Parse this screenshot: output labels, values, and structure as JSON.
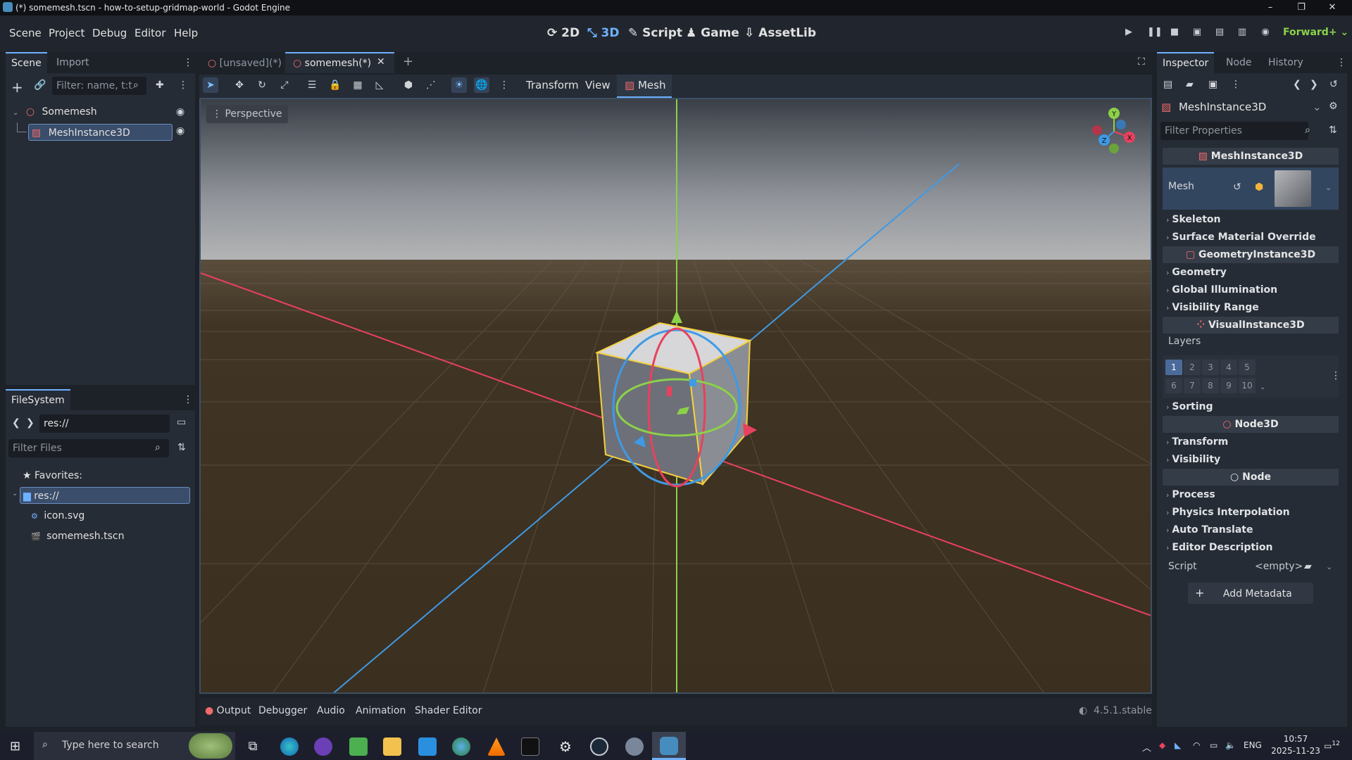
{
  "window": {
    "title": "(*) somemesh.tscn - how-to-setup-gridmap-world - Godot Engine",
    "minimize": "–",
    "maximize": "❐",
    "close": "✕"
  },
  "menu": {
    "scene": "Scene",
    "project": "Project",
    "debug": "Debug",
    "editor": "Editor",
    "help": "Help"
  },
  "modes": {
    "m2d": "2D",
    "m3d": "3D",
    "script": "Script",
    "game": "Game",
    "assetlib": "AssetLib"
  },
  "renderer": "Forward+",
  "scene_dock": {
    "tabs": [
      "Scene",
      "Import"
    ],
    "filter_placeholder": "Filter: name, t:t",
    "nodes": [
      {
        "name": "Somemesh"
      },
      {
        "name": "MeshInstance3D"
      }
    ]
  },
  "filesystem": {
    "tab": "FileSystem",
    "path": "res://",
    "filter_placeholder": "Filter Files",
    "favorites": "Favorites:",
    "root": "res://",
    "files": [
      "icon.svg",
      "somemesh.tscn"
    ]
  },
  "editor_tabs": {
    "tab1": "[unsaved](*)",
    "tab2": "somemesh(*)",
    "add": "+"
  },
  "viewport_toolbar": {
    "transform": "Transform",
    "view": "View",
    "mesh": "Mesh"
  },
  "viewport": {
    "perspective": "Perspective",
    "gizmo_x": "X",
    "gizmo_y": "Y",
    "gizmo_z": "Z"
  },
  "inspector": {
    "tabs": [
      "Inspector",
      "Node",
      "History"
    ],
    "node_selector": "MeshInstance3D",
    "filter_placeholder": "Filter Properties",
    "class_mesh": "MeshInstance3D",
    "mesh_label": "Mesh",
    "mesh_sections": [
      "Skeleton",
      "Surface Material Override"
    ],
    "class_geometry": "GeometryInstance3D",
    "geometry_sections": [
      "Geometry",
      "Global Illumination",
      "Visibility Range"
    ],
    "class_visual": "VisualInstance3D",
    "layers_label": "Layers",
    "layers": [
      "1",
      "2",
      "3",
      "4",
      "5",
      "6",
      "7",
      "8",
      "9",
      "10"
    ],
    "sorting": "Sorting",
    "class_node3d": "Node3D",
    "node3d_sections": [
      "Transform",
      "Visibility"
    ],
    "class_node": "Node",
    "node_sections": [
      "Process",
      "Physics Interpolation",
      "Auto Translate",
      "Editor Description"
    ],
    "script_label": "Script",
    "script_value": "<empty>",
    "add_metadata": "Add Metadata"
  },
  "bottom_panel": {
    "output": "Output",
    "debugger": "Debugger",
    "audio": "Audio",
    "animation": "Animation",
    "shader_editor": "Shader Editor",
    "version": "4.5.1.stable"
  },
  "taskbar": {
    "search": "Type here to search",
    "lang": "ENG",
    "time": "10:57",
    "date": "2025-11-23",
    "notifications": "12"
  },
  "colors": {
    "accent": "#6fb1ff",
    "x_axis": "#e8415d",
    "y_axis": "#8cd14a",
    "z_axis": "#3e9ae6",
    "selection": "#f4d03f"
  }
}
